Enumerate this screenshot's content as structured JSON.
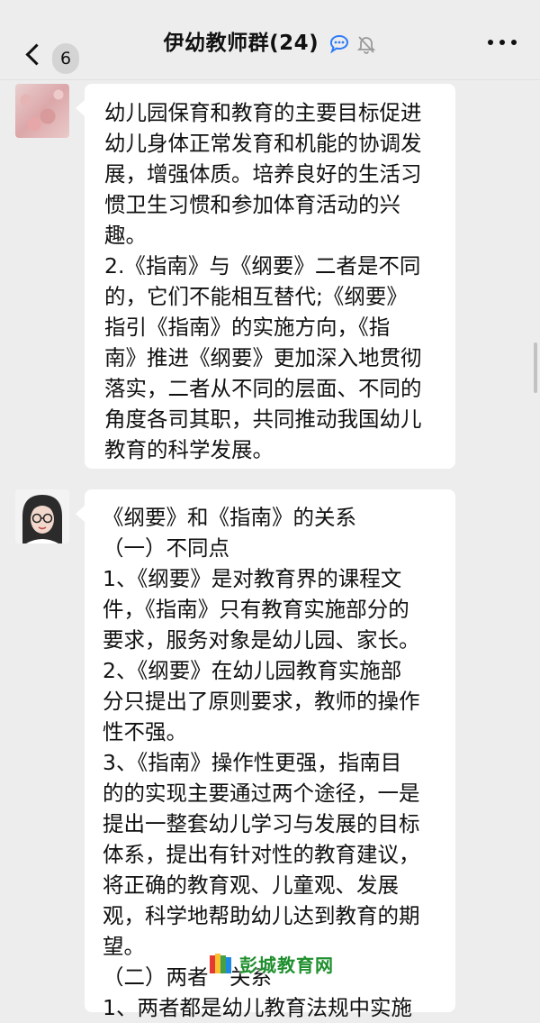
{
  "header": {
    "back_label": "back",
    "unread_count": "6",
    "title": "伊幼教师群(24)",
    "icons": [
      "back-chevron-icon",
      "chat-bubble-icon",
      "mute-bell-icon",
      "more-icon"
    ]
  },
  "messages": [
    {
      "sender_avatar": "avatar-pink-pattern",
      "lines": [
        "幼儿园保育和教育的主要目标促进",
        "幼儿身体正常发育和机能的协调发",
        "展，增强体质。培养良好的生活习",
        "惯卫生习惯和参加体育活动的兴",
        "趣。",
        "2.《指南》与《纲要》二者是不同",
        "的，它们不能相互替代;《纲要》",
        "指引《指南》的实施方向，《指",
        "南》推进《纲要》更加深入地贯彻",
        "落实，二者从不同的层面、不同的",
        "角度各司其职，共同推动我国幼儿",
        "教育的科学发展。"
      ]
    },
    {
      "sender_avatar": "avatar-girl-glasses",
      "lines": [
        "《纲要》和《指南》的关系",
        "（一）不同点",
        "1、《纲要》是对教育界的课程文",
        "件，《指南》只有教育实施部分的",
        "要求，服务对象是幼儿园、家长。",
        "2、《纲要》在幼儿园教育实施部",
        "分只提出了原则要求，教师的操作",
        "性不强。",
        "3、《指南》操作性更强，指南目",
        "的的实现主要通过两个途径，一是",
        "提出一整套幼儿学习与发展的目标",
        "体系，提出有针对性的教育建议，",
        "将正确的教育观、儿童观、发展",
        "观，科学地帮助幼儿达到教育的期",
        "望。",
        "（二）两者　关系",
        "1、两者都是幼儿教育法规中实施"
      ]
    }
  ],
  "watermark": {
    "text": "彭城教育网",
    "colors": [
      "#e53935",
      "#fbc02d",
      "#43a047",
      "#1e88e5"
    ]
  }
}
